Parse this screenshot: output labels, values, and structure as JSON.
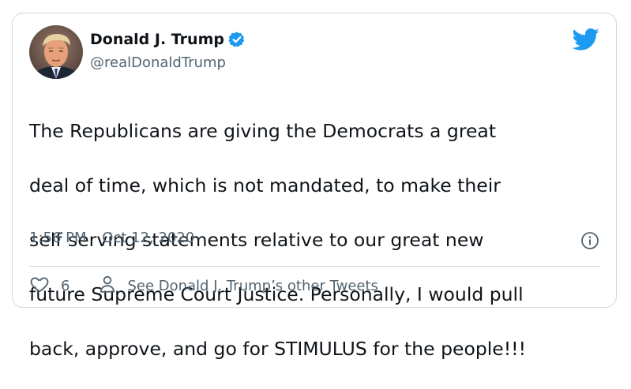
{
  "author": {
    "name": "Donald J. Trump",
    "handle": "@realDonaldTrump",
    "verified": true,
    "avatar": "profile-photo"
  },
  "tweet": {
    "lines": [
      "The Republicans are giving the Democrats a great",
      "deal of time, which is not mandated, to make their",
      "self serving statements relative to our great new",
      "future Supreme Court Justice. Personally, I would pull",
      "back, approve, and go for STIMULUS for the people!!!"
    ],
    "time": "1:56 PM",
    "separator": "·",
    "date": "Oct 12, 2020"
  },
  "actions": {
    "like_count": "6",
    "profile_link": "See Donald J. Trump’s other Tweets"
  },
  "icons": {
    "brand": "twitter-bird-icon",
    "verified": "verified-badge-icon",
    "info": "info-icon",
    "like": "heart-icon",
    "profile": "person-icon"
  },
  "colors": {
    "brand_blue": "#1d9bf0",
    "text": "#0f1419",
    "secondary_text": "#536471",
    "border": "#cfd9de"
  }
}
